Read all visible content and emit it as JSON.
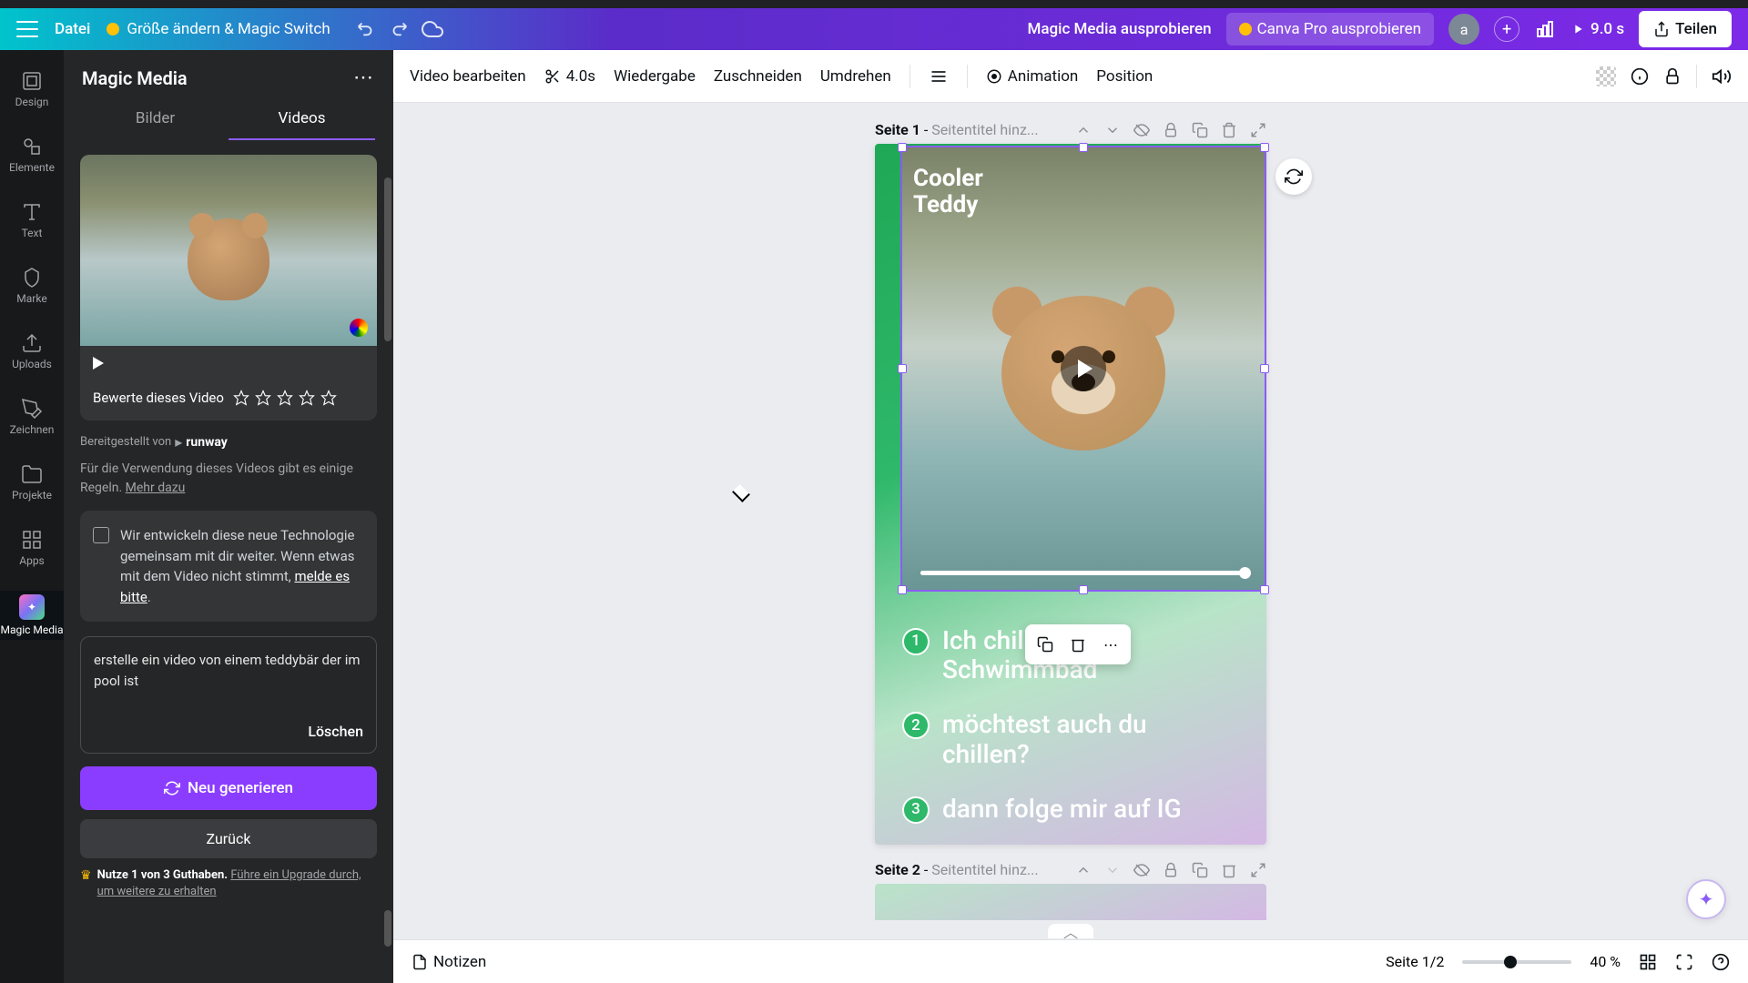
{
  "topbar": {
    "file": "Datei",
    "resize_switch": "Größe ändern & Magic Switch",
    "try_magic": "Magic Media ausprobieren",
    "try_pro": "Canva Pro ausprobieren",
    "avatar_initial": "a",
    "duration": "9.0 s",
    "share": "Teilen"
  },
  "rail": [
    {
      "label": "Design",
      "icon": "design"
    },
    {
      "label": "Elemente",
      "icon": "elements"
    },
    {
      "label": "Text",
      "icon": "text"
    },
    {
      "label": "Marke",
      "icon": "brand"
    },
    {
      "label": "Uploads",
      "icon": "uploads"
    },
    {
      "label": "Zeichnen",
      "icon": "draw"
    },
    {
      "label": "Projekte",
      "icon": "projects"
    },
    {
      "label": "Apps",
      "icon": "apps"
    },
    {
      "label": "Magic Media",
      "icon": "magic"
    }
  ],
  "sidepanel": {
    "title": "Magic Media",
    "tabs": {
      "images": "Bilder",
      "videos": "Videos"
    },
    "rate_label": "Bewerte dieses Video",
    "provider_prefix": "Bereitgestellt von",
    "provider": "runway",
    "usage_note": "Für die Verwendung dieses Videos gibt es einige Regeln.",
    "usage_link": "Mehr dazu",
    "feedback": "Wir entwickeln diese neue Technologie gemeinsam mit dir weiter. Wenn etwas mit dem Video nicht stimmt, ",
    "feedback_link": "melde es bitte",
    "prompt": "erstelle ein video von einem teddybär der im pool ist",
    "clear": "Löschen",
    "generate": "Neu generieren",
    "back": "Zurück",
    "credits_bold": "Nutze 1 von 3 Guthaben.",
    "credits_link": "Führe ein Upgrade durch, um weitere zu erhalten"
  },
  "toolbar": {
    "edit_video": "Video bearbeiten",
    "duration": "4.0s",
    "playback": "Wiedergabe",
    "crop": "Zuschneiden",
    "flip": "Umdrehen",
    "animation": "Animation",
    "position": "Position"
  },
  "pages": {
    "p1_label": "Seite 1",
    "p2_label": "Seite 2",
    "title_hint": "Seitentitel hinz...",
    "sep": " - "
  },
  "design": {
    "badge_line1": "Cooler",
    "badge_line2": "Teddy",
    "item1": "Ich chille im Schwimmbad",
    "item2": "möchtest auch du chillen?",
    "item3": "dann folge mir auf IG"
  },
  "bottombar": {
    "notes": "Notizen",
    "page_indicator": "Seite 1/2",
    "zoom": "40 %"
  }
}
